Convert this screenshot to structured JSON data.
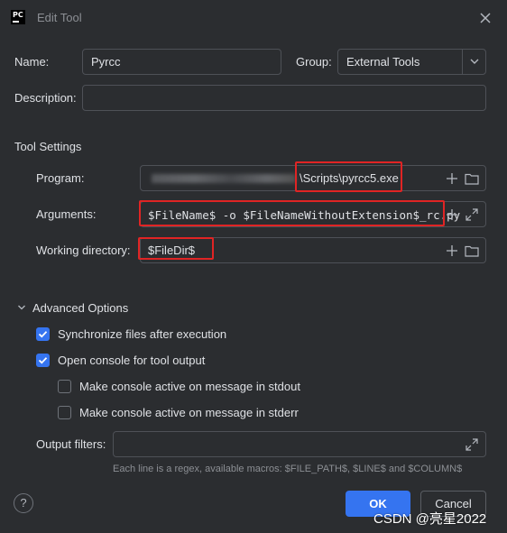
{
  "window": {
    "logo_text": "PC",
    "title": "Edit Tool"
  },
  "form": {
    "name_label": "Name:",
    "name_value": "Pyrcc",
    "group_label": "Group:",
    "group_value": "External Tools",
    "description_label": "Description:",
    "description_value": ""
  },
  "tool_settings": {
    "section_title": "Tool Settings",
    "program_label": "Program:",
    "program_value": "\\Scripts\\pyrcc5.exe",
    "arguments_label": "Arguments:",
    "arguments_value": "$FileName$ -o $FileNameWithoutExtension$_rc.py",
    "working_dir_label": "Working directory:",
    "working_dir_value": "$FileDir$"
  },
  "advanced": {
    "section_title": "Advanced Options",
    "options": [
      {
        "label": "Synchronize files after execution",
        "checked": true
      },
      {
        "label": "Open console for tool output",
        "checked": true
      },
      {
        "label": "Make console active on message in stdout",
        "checked": false
      },
      {
        "label": "Make console active on message in stderr",
        "checked": false
      }
    ],
    "output_filters_label": "Output filters:",
    "output_filters_value": "",
    "hint": "Each line is a regex, available macros: $FILE_PATH$, $LINE$ and $COLUMN$"
  },
  "footer": {
    "help_label": "?",
    "ok_label": "OK",
    "cancel_label": "Cancel",
    "watermark": "CSDN @亮星2022"
  },
  "colors": {
    "background": "#2b2d30",
    "accent": "#3574f0",
    "highlight_box": "#e02424"
  }
}
